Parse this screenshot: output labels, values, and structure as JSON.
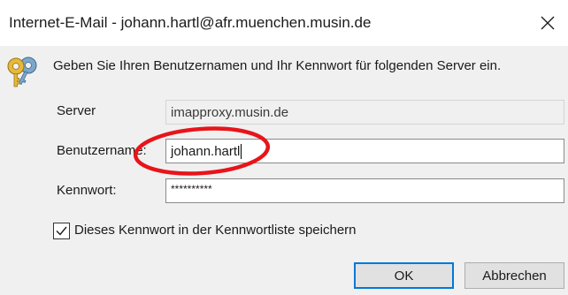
{
  "window": {
    "title": "Internet-E-Mail - johann.hartl@afr.muenchen.musin.de",
    "close_icon": "close-icon"
  },
  "dialog": {
    "icon": "keys-icon",
    "message": "Geben Sie Ihren Benutzernamen und Ihr Kennwort für folgenden Server ein.",
    "server": {
      "label": "Server",
      "value": "imapproxy.musin.de"
    },
    "username": {
      "label": "Benutzername:",
      "value": "johann.hartl"
    },
    "password": {
      "label": "Kennwort:",
      "value": "**********"
    },
    "remember": {
      "checked": true,
      "label": "Dieses Kennwort in der Kennwortliste speichern"
    },
    "buttons": {
      "ok": "OK",
      "cancel": "Abbrechen"
    }
  },
  "annotation": {
    "shape": "ellipse",
    "color": "#e8141b"
  },
  "colors": {
    "focus_border": "#0078d7",
    "background": "#f0f0f0",
    "titlebar": "#ffffff"
  }
}
